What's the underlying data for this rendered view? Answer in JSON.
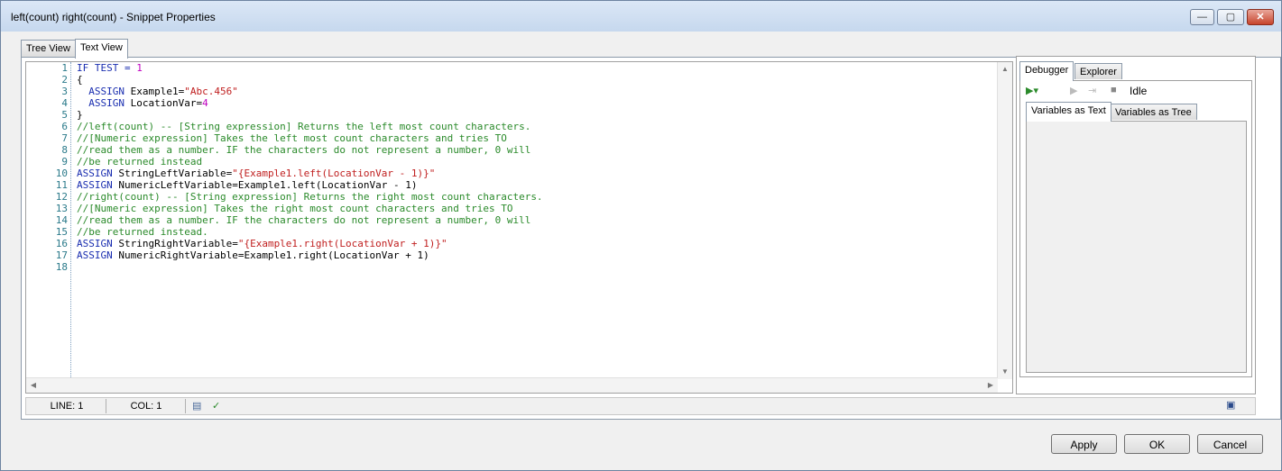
{
  "window": {
    "title": "left(count) right(count) - Snippet Properties",
    "minimize": "—",
    "maximize": "▢",
    "close": "✕"
  },
  "tabs": [
    {
      "label": "Tree View",
      "active": false
    },
    {
      "label": "Text View",
      "active": true
    }
  ],
  "editor": {
    "line_numbers": [
      "1",
      "2",
      "3",
      "4",
      "5",
      "6",
      "7",
      "8",
      "9",
      "10",
      "11",
      "12",
      "13",
      "14",
      "15",
      "16",
      "17",
      "18"
    ]
  },
  "status": {
    "line": "LINE: 1",
    "col": "COL: 1"
  },
  "debugger": {
    "tabs": [
      {
        "label": "Debugger",
        "active": true
      },
      {
        "label": "Explorer",
        "active": false
      }
    ],
    "state": "Idle",
    "subtabs": [
      {
        "label": "Variables as Text",
        "active": true
      },
      {
        "label": "Variables as Tree",
        "active": false
      }
    ]
  },
  "buttons": {
    "apply": "Apply",
    "ok": "OK",
    "cancel": "Cancel"
  },
  "colors": {
    "keyword": "#1a2eb0",
    "number": "#c000c0",
    "string": "#c02020",
    "comment": "#2a8a2a"
  }
}
